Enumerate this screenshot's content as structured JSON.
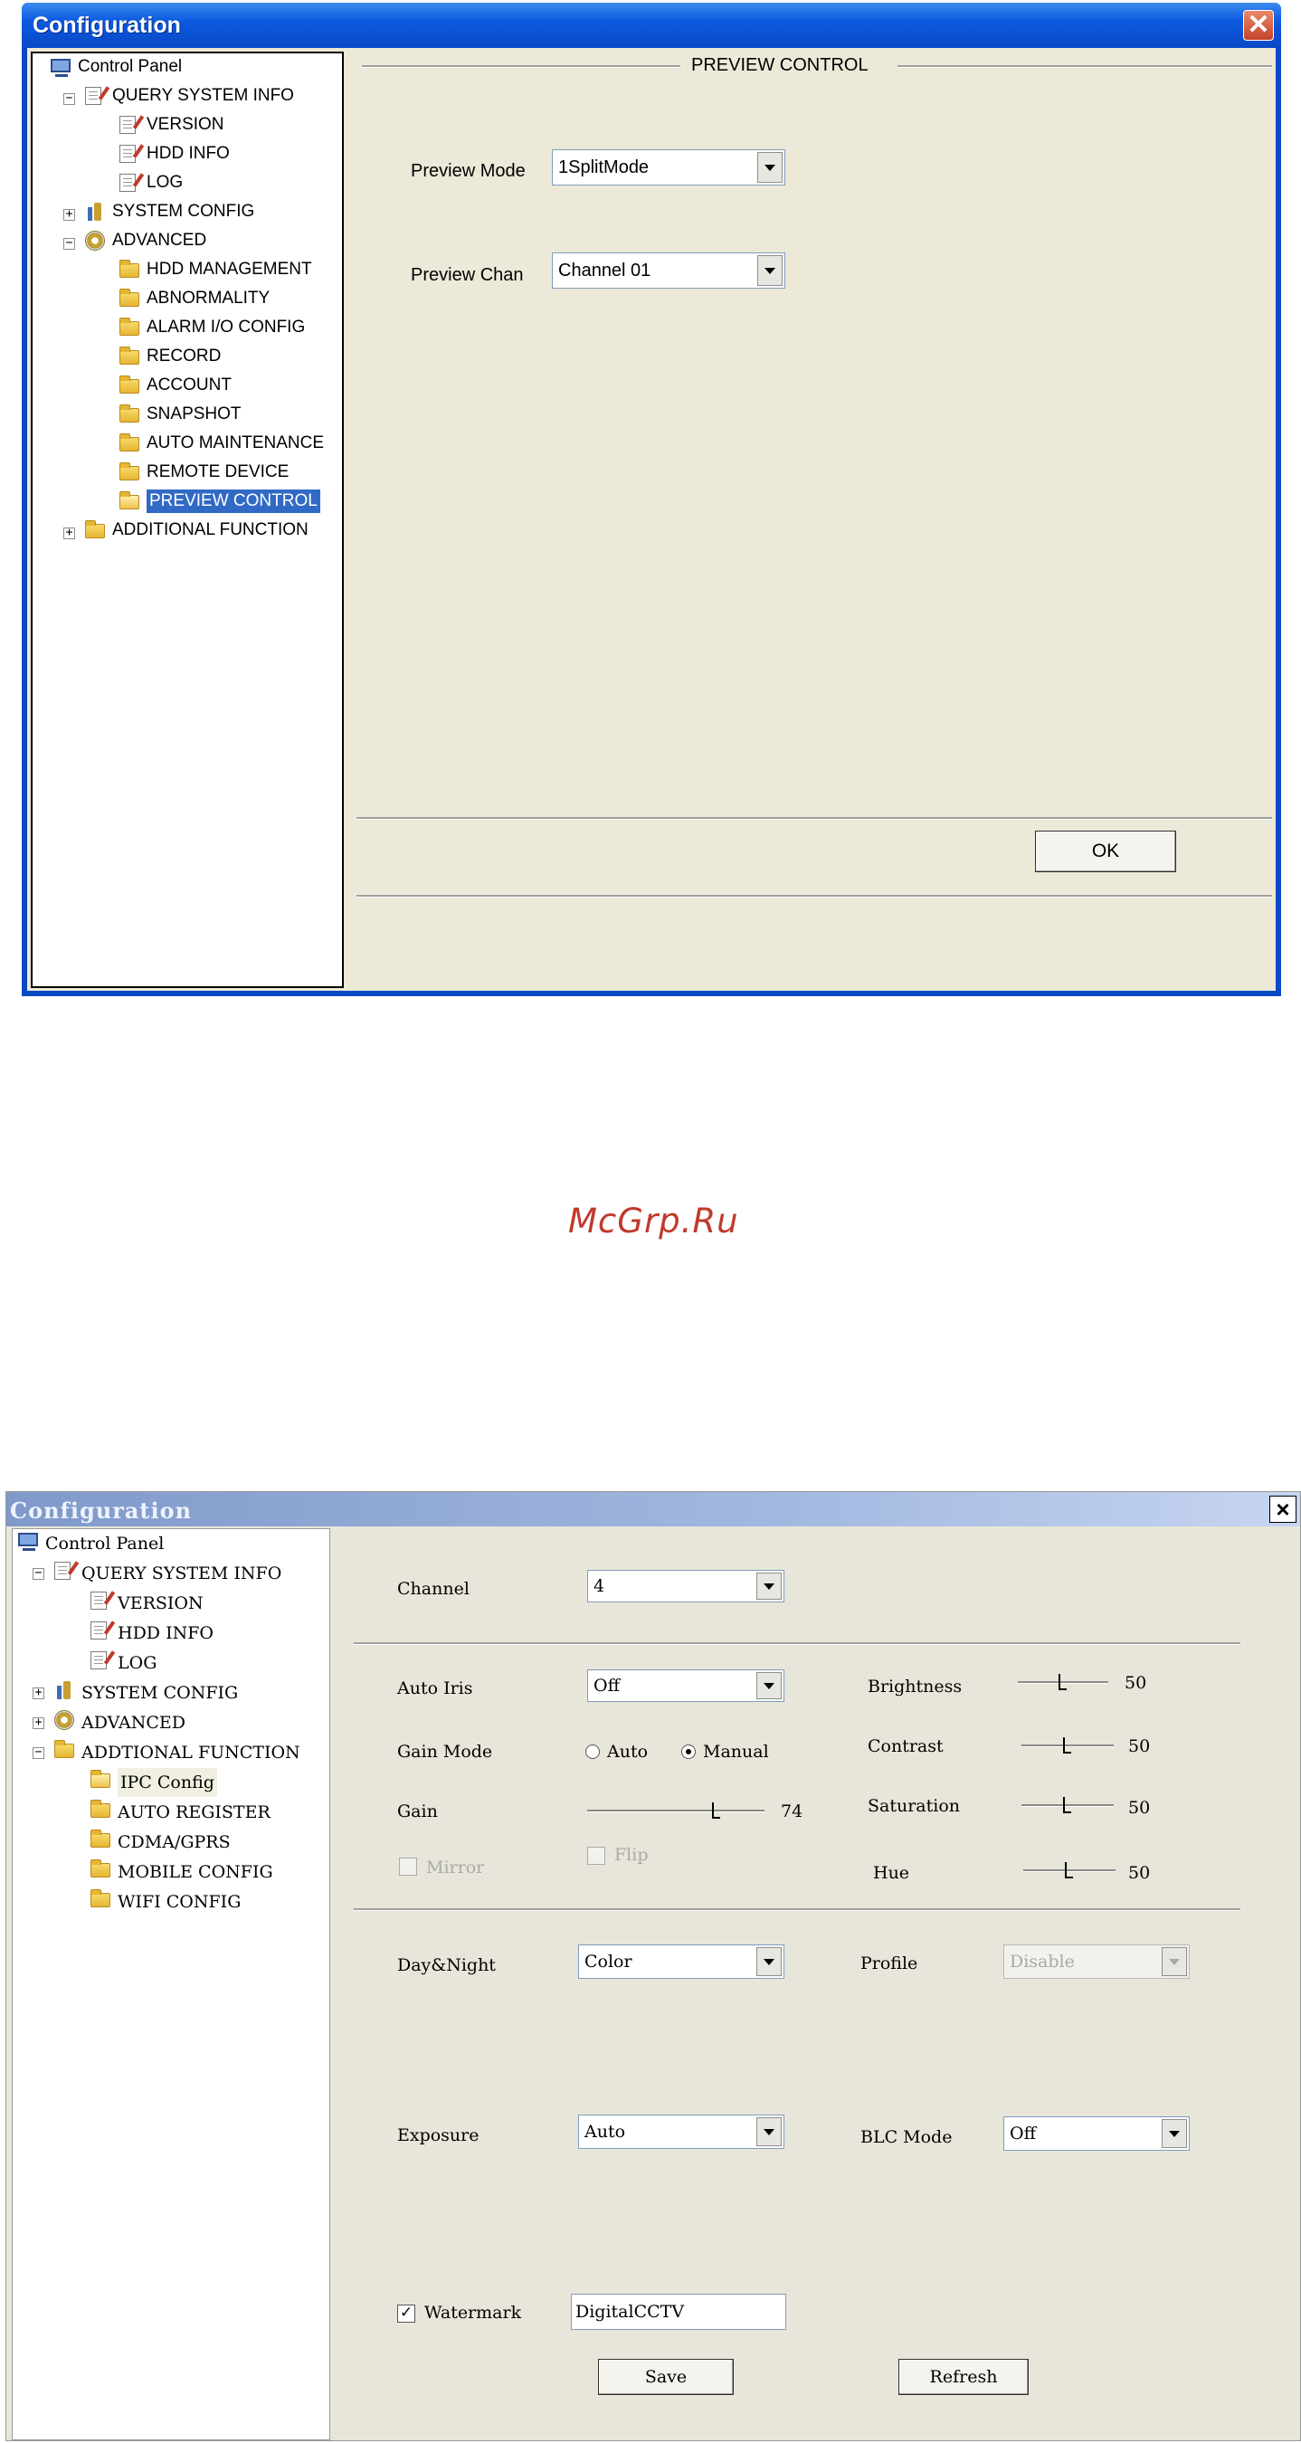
{
  "window1": {
    "title": "Configuration",
    "close_glyph": "✕",
    "tree": [
      {
        "label": "Control Panel",
        "icon": "monitor-icon"
      },
      {
        "label": "QUERY SYSTEM INFO",
        "icon": "doc-icon",
        "expander": "−"
      },
      {
        "label": "VERSION",
        "icon": "doc-icon"
      },
      {
        "label": "HDD INFO",
        "icon": "doc-icon"
      },
      {
        "label": "LOG",
        "icon": "doc-icon"
      },
      {
        "label": "SYSTEM CONFIG",
        "icon": "tool-icon",
        "expander": "+"
      },
      {
        "label": "ADVANCED",
        "icon": "gear-icon",
        "expander": "−"
      },
      {
        "label": "HDD MANAGEMENT",
        "icon": "folder-icon"
      },
      {
        "label": "ABNORMALITY",
        "icon": "folder-icon"
      },
      {
        "label": "ALARM I/O CONFIG",
        "icon": "folder-icon"
      },
      {
        "label": "RECORD",
        "icon": "folder-icon"
      },
      {
        "label": "ACCOUNT",
        "icon": "folder-icon"
      },
      {
        "label": "SNAPSHOT",
        "icon": "folder-icon"
      },
      {
        "label": "AUTO MAINTENANCE",
        "icon": "folder-icon"
      },
      {
        "label": "REMOTE DEVICE",
        "icon": "folder-icon"
      },
      {
        "label": "PREVIEW CONTROL",
        "icon": "folder-open-icon",
        "selected": true
      },
      {
        "label": "ADDITIONAL FUNCTION",
        "icon": "folder-icon",
        "expander": "+"
      }
    ],
    "section_title": "PREVIEW CONTROL",
    "preview_mode_label": "Preview Mode",
    "preview_mode_value": "1SplitMode",
    "preview_chan_label": "Preview Chan",
    "preview_chan_value": "Channel 01",
    "ok_label": "OK"
  },
  "watermark": "McGrp.Ru",
  "window2": {
    "title": "Configuration",
    "close_glyph": "×",
    "tree": [
      {
        "label": "Control Panel",
        "icon": "monitor-icon"
      },
      {
        "label": "QUERY SYSTEM INFO",
        "icon": "doc-icon",
        "expander": "−"
      },
      {
        "label": "VERSION",
        "icon": "doc-icon"
      },
      {
        "label": "HDD INFO",
        "icon": "doc-icon"
      },
      {
        "label": "LOG",
        "icon": "doc-icon"
      },
      {
        "label": "SYSTEM CONFIG",
        "icon": "tool-icon",
        "expander": "+"
      },
      {
        "label": "ADVANCED",
        "icon": "gear-icon",
        "expander": "+"
      },
      {
        "label": "ADDTIONAL FUNCTION",
        "icon": "folder-icon",
        "expander": "−"
      },
      {
        "label": "IPC Config",
        "icon": "folder-open-icon",
        "selected": true
      },
      {
        "label": "AUTO REGISTER",
        "icon": "folder-icon"
      },
      {
        "label": "CDMA/GPRS",
        "icon": "folder-icon"
      },
      {
        "label": "MOBILE CONFIG",
        "icon": "folder-icon"
      },
      {
        "label": "WIFI CONFIG",
        "icon": "folder-icon"
      }
    ],
    "channel_label": "Channel",
    "channel_value": "4",
    "auto_iris_label": "Auto Iris",
    "auto_iris_value": "Off",
    "gain_mode_label": "Gain Mode",
    "gain_mode_auto": "Auto",
    "gain_mode_manual": "Manual",
    "gain_mode_selected": "Manual",
    "gain_label": "Gain",
    "gain_value": "74",
    "mirror_label": "Mirror",
    "flip_label": "Flip",
    "brightness_label": "Brightness",
    "brightness_value": "50",
    "contrast_label": "Contrast",
    "contrast_value": "50",
    "saturation_label": "Saturation",
    "saturation_value": "50",
    "hue_label": "Hue",
    "hue_value": "50",
    "day_night_label": "Day&Night",
    "day_night_value": "Color",
    "profile_label": "Profile",
    "profile_value": "Disable",
    "exposure_label": "Exposure",
    "exposure_value": "Auto",
    "blc_mode_label": "BLC Mode",
    "blc_mode_value": "Off",
    "watermark_label": "Watermark",
    "watermark_checked": true,
    "watermark_check_glyph": "✓",
    "watermark_value": "DigitalCCTV",
    "save_label": "Save",
    "refresh_label": "Refresh"
  }
}
